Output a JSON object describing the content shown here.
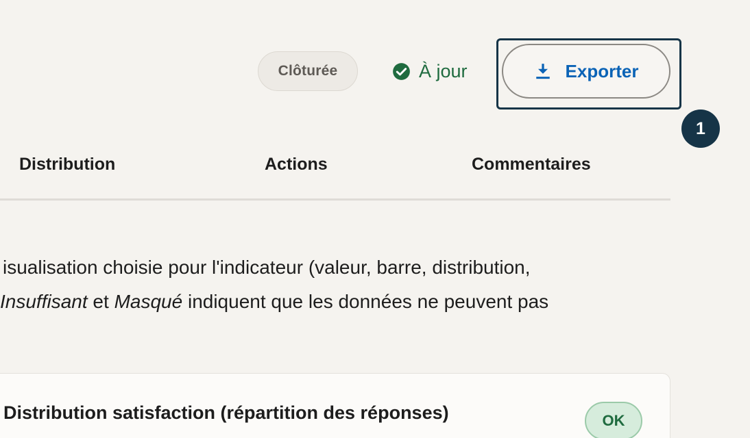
{
  "header": {
    "closed_badge": "Clôturée",
    "sync_status": "À jour",
    "export_label": "Exporter",
    "step_marker": "1"
  },
  "tabs": [
    {
      "label": "Distribution"
    },
    {
      "label": "Actions"
    },
    {
      "label": "Commentaires"
    }
  ],
  "description": {
    "line1": "isualisation choisie pour l'indicateur (valeur, barre, distribution,",
    "line2_em1": "Insuffisant",
    "line2_mid": " et ",
    "line2_em2": "Masqué",
    "line2_rest": " indiquent que les données ne peuvent pas"
  },
  "card": {
    "title": "Distribution satisfaction (répartition des réponses)",
    "status": "OK"
  },
  "colors": {
    "accent": "#0b63b6",
    "success": "#1f6b3f",
    "focus": "#163447"
  },
  "icons": {
    "status": "check-circle-icon",
    "export": "download-icon"
  }
}
